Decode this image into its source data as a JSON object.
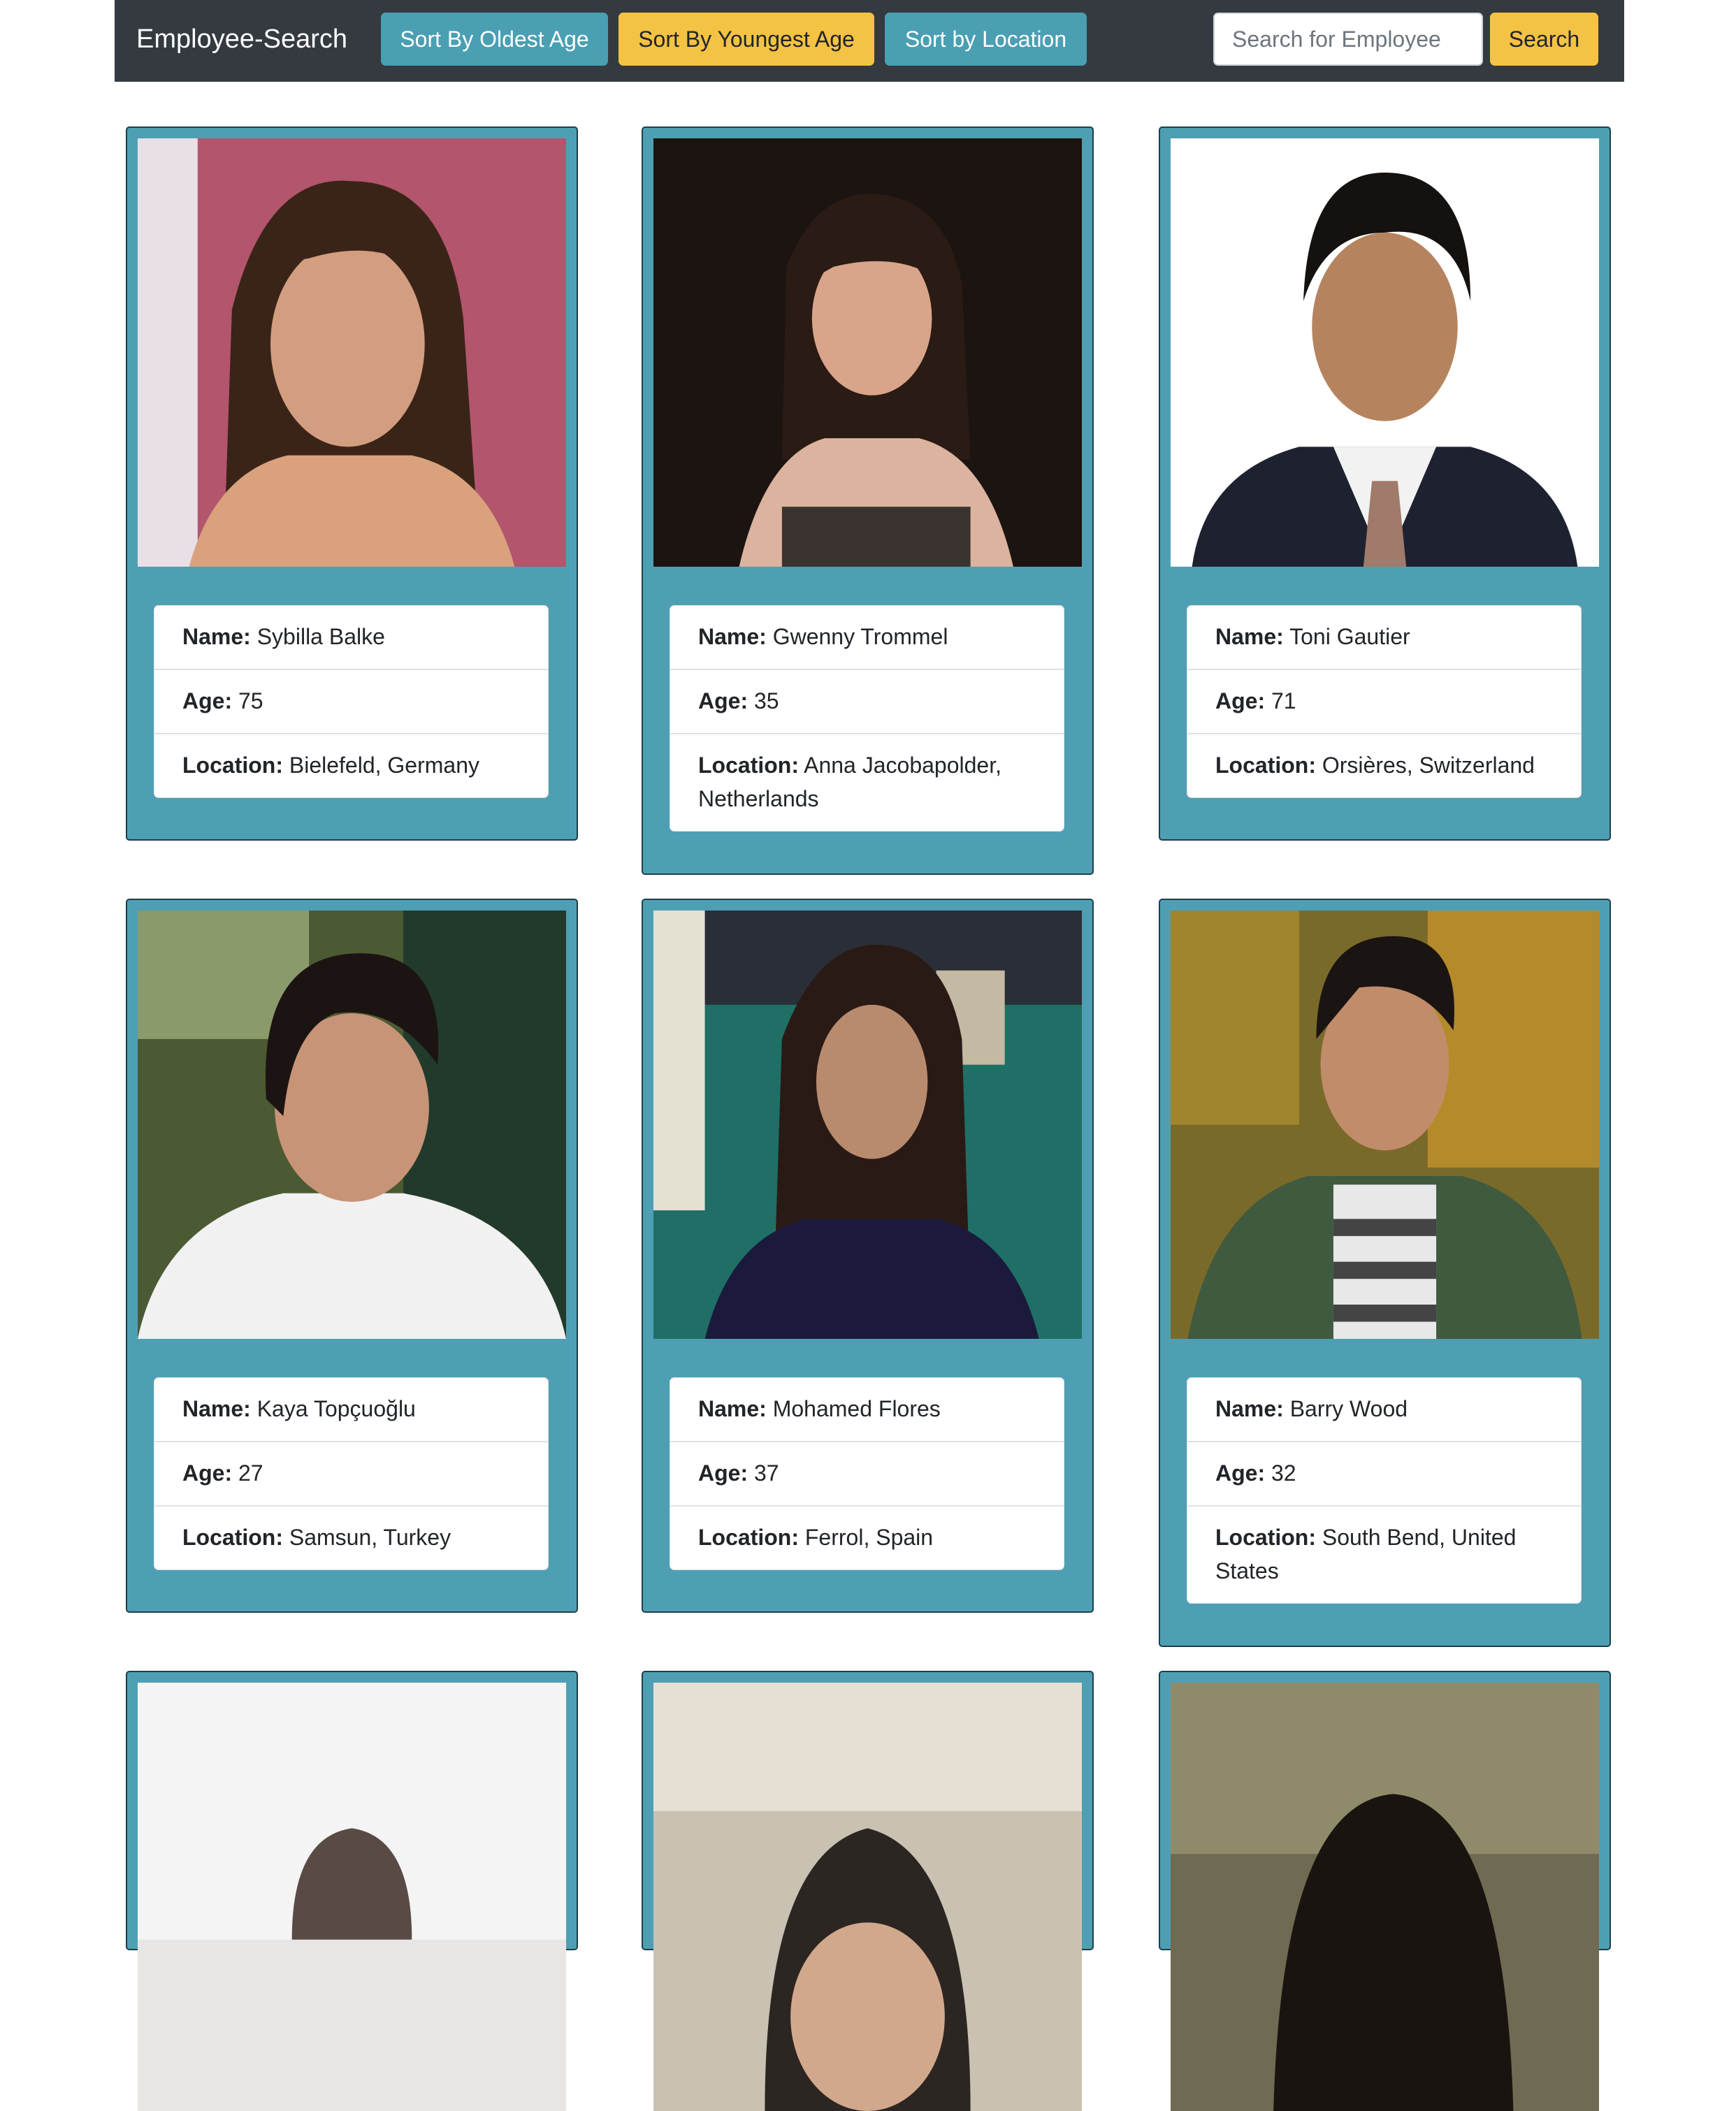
{
  "navbar": {
    "brand": "Employee-Search",
    "sort_oldest": "Sort By Oldest Age",
    "sort_youngest": "Sort By Youngest Age",
    "sort_location": "Sort by Location",
    "search_placeholder": "Search for Employee",
    "search_button": "Search"
  },
  "labels": {
    "name": "Name:",
    "age": "Age:",
    "location": "Location:"
  },
  "employees": [
    {
      "name": "Sybilla Balke",
      "age": "75",
      "location": "Bielefeld, Germany"
    },
    {
      "name": "Gwenny Trommel",
      "age": "35",
      "location": "Anna Jacobapolder, Netherlands"
    },
    {
      "name": "Toni Gautier",
      "age": "71",
      "location": "Orsières, Switzerland"
    },
    {
      "name": "Kaya Topçuoğlu",
      "age": "27",
      "location": "Samsun, Turkey"
    },
    {
      "name": "Mohamed Flores",
      "age": "37",
      "location": "Ferrol, Spain"
    },
    {
      "name": "Barry Wood",
      "age": "32",
      "location": "South Bend, United States"
    }
  ],
  "colors": {
    "navbar": "#343a40",
    "info_button": "#4a9fb3",
    "warning_button": "#f5c343",
    "card": "#4f9fb4"
  }
}
